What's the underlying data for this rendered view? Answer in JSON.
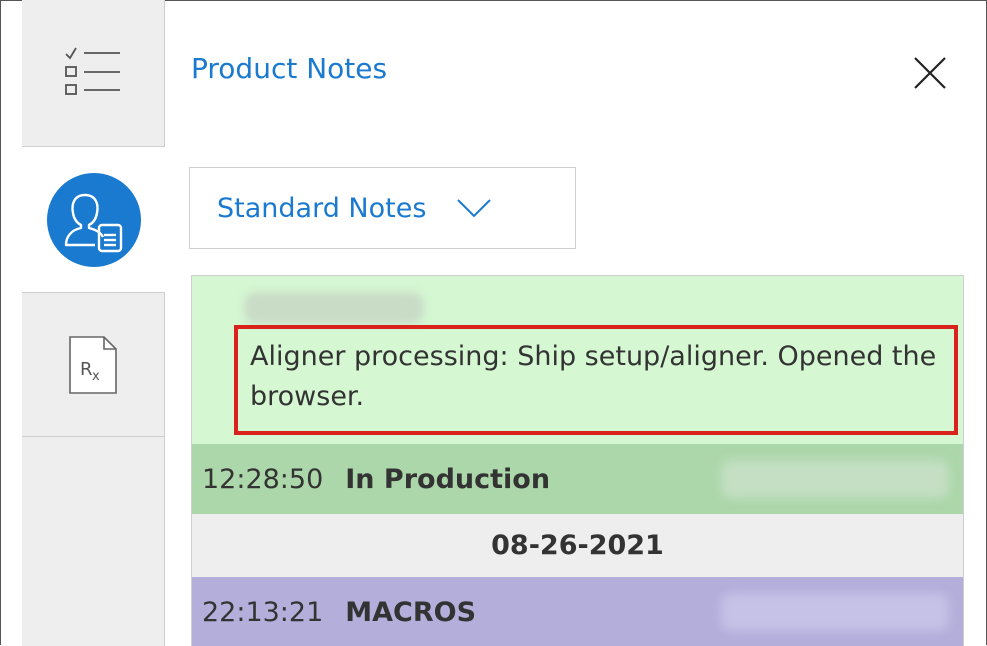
{
  "panel": {
    "title": "Product Notes"
  },
  "dropdown": {
    "selected": "Standard Notes"
  },
  "notes": {
    "highlighted_note": "Aligner processing: Ship setup/aligner. Opened the browser.",
    "rows": [
      {
        "time": "12:28:50",
        "status": "In Production"
      },
      {
        "date": "08-26-2021"
      },
      {
        "time": "22:13:21",
        "status": "MACROS"
      }
    ]
  },
  "icons": {
    "checklist": "checklist-icon",
    "profile": "user-document-icon",
    "rx": "rx-document-icon",
    "close": "close-icon",
    "chevron": "chevron-down-icon"
  },
  "colors": {
    "accent": "#1a7ad0",
    "note_green": "#d5f7d2",
    "production_green": "#acd7aa",
    "macros_purple": "#b4aedb",
    "highlight_red": "#d8221b"
  }
}
